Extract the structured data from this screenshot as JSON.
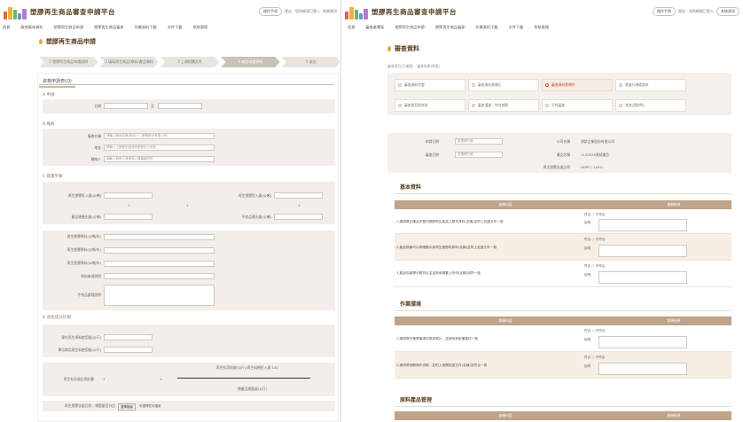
{
  "left": {
    "site_title": "塑膠再生商品審查申請平台",
    "header_links": [
      "操作手冊",
      "登出 - 您的帳號已登入",
      "系統資訊"
    ],
    "nav": [
      "首頁",
      "廠商基本資料",
      "塑膠再生商品申請",
      "塑膠再生商品審查",
      "作業資料下載",
      "文件下載",
      "系統管理"
    ],
    "page_title": "塑膠再生商品申請",
    "steps": [
      "1 塑膠再生商品申請說明",
      "2 填寫再生商品/原料/產品資料",
      "3 上傳相關文件",
      "4 確認申請資料",
      "5 送出"
    ],
    "form_tab": "資格申請表(Q)",
    "section_application": "A 申請",
    "date_label": "日期",
    "date_sep": "至",
    "section_company": "B 廠商",
    "company_name_label": "廠商名稱",
    "company_name_placeholder": "請輸入廠商名稱(例如:○○實業股份有限公司)",
    "address_label": "地址",
    "address_placeholder": "請輸入工廠登記證或商業登記之地址",
    "contact_label": "聯絡人",
    "contact_placeholder": "請輸入負責人或專責人員聯絡資訊",
    "section_mass_balance": "C 質量平衡",
    "input_labels": [
      "原生塑膠投入量(公噸)",
      "再生塑膠投入量(公噸)",
      "產品總產出量(公噸)",
      "不良品產出量(公噸)"
    ],
    "plus_signs": [
      "+",
      "+",
      "+",
      "+"
    ],
    "ratio_labels": [
      "再生塑膠原料(公噸/年)",
      "再生塑膠原料(公噸/年)",
      "再生塑膠原料(公噸/年)",
      "原料來源說明",
      "不良品處理說明"
    ],
    "section_content": "D 再生成分比例",
    "content_labels": [
      "單位再生原料使用量(公斤)",
      "單位商品再生料使用量(公斤)"
    ],
    "formula_label": "再生料含量比例計算",
    "formula_value": "1",
    "formula_times": "×",
    "formula_top": "再生料添加量(公斤)/再生料總投入量 100",
    "formula_bottom": "總產品總重量(公斤)",
    "bottom_label": "再生塑膠含量比例 - 總重量百分比",
    "bottom_button": "選擇檔案",
    "bottom_note": "未選擇任何檔案"
  },
  "right": {
    "site_title": "塑膠再生商品審查申請平台",
    "header_links": [
      "操作手冊",
      "登出 - 您的帳號已登入",
      "系統資訊"
    ],
    "nav": [
      "首頁",
      "審查者專區",
      "塑膠再生商品申請",
      "塑膠再生商品審查",
      "作業資料下載",
      "文件下載",
      "系統管理"
    ],
    "page_title": "審查資料",
    "filter_label": "審查項目(可複選) - 審查結果(單選)",
    "radio_options": [
      "審查資料完整",
      "審查資料需補正",
      "審查資料需補件",
      "需進行現場查核",
      "審查意見需修改",
      "審查通過 - 符合規範",
      "不符審查",
      "其他(請說明)"
    ],
    "selected_index": 2,
    "info": {
      "apply_date_label": "申請日期",
      "apply_date_placeholder": "請選擇日期",
      "review_date_label": "審查日期",
      "review_date_placeholder": "請選擇日期",
      "company_label": "公司名稱",
      "company_value": "測試企業股份有限公司",
      "product_label": "產品名稱",
      "product_value": "1120526測試產品",
      "ratio_label": "再生塑膠含量比例",
      "ratio_value": "HDPE / 100%"
    },
    "sections": [
      {
        "title": "基本資料",
        "col_content": "查驗內容",
        "col_result": "查驗結果",
        "rows": [
          "1.請填寫正確且完整的塑膠再生商品之基本資料(名稱)並附上佐證文件一致",
          "2.產品規格可以明確顯示其再生塑膠料原料(名稱)並附上佐證文件一致",
          "3.產品包裝標示應符合並且與申請書上所列(名稱)相符一致"
        ]
      },
      {
        "title": "作業環境",
        "col_content": "查驗內容",
        "col_result": "查驗結果",
        "rows": [
          "1.請填寫作業環境現況與其照片 - 並說明其設備運作一致",
          "2.請填寫相關操作流程 - 並附上相關佐證文件(名稱)並符合一致"
        ]
      },
      {
        "title": "原料產品管理",
        "col_content": "查驗內容",
        "col_result": "查驗結果",
        "rows": []
      }
    ],
    "check_yes": "符合",
    "check_no": "不符合",
    "note_label": "說明"
  }
}
